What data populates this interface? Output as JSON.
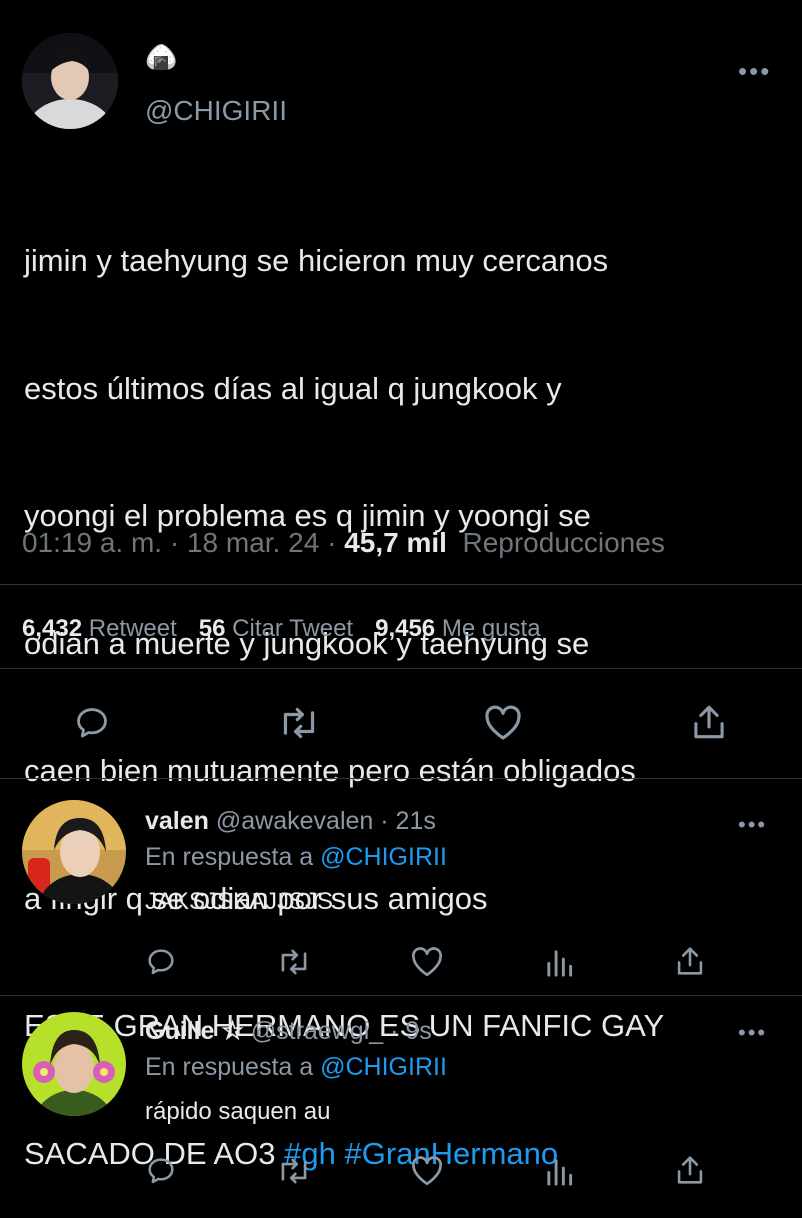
{
  "tweet": {
    "display_name_emoji": "🍙",
    "handle": "@CHIGIRII",
    "text_lines": [
      "jimin y taehyung se hicieron muy cercanos",
      "estos últimos días al igual q jungkook y",
      "yoongi el problema es q jimin y yoongi se",
      "odian a muerte y jungkook y taehyung se",
      "caen bien mutuamente pero están obligados",
      "a fingir q se odian por sus amigos",
      "ESTE GRAN HERMANO ES UN FANFIC GAY",
      "SACADO DE AO3 "
    ],
    "hashtags": [
      "#gh",
      "#GranHermano"
    ],
    "time": "01:19 a. m.",
    "date": "18 mar. 24",
    "views_count": "45,7 mil",
    "views_label": "Reproducciones",
    "retweets_count": "6,432",
    "retweets_label": "Retweet",
    "quotes_count": "56",
    "quotes_label": "Citar Tweet",
    "likes_count": "9,456",
    "likes_label": "Me gusta",
    "more": "•••"
  },
  "replies": [
    {
      "name": "valen",
      "handle": "@awakevalen",
      "time": "· 21s",
      "reply_to_label": "En respuesta a",
      "reply_to_handle": "@CHIGIRII",
      "text": "JAKSJSKAJJSJS",
      "more": "•••"
    },
    {
      "name": "Guille ☆",
      "handle": "@straewgi_",
      "time": "· 9s",
      "reply_to_label": "En respuesta a",
      "reply_to_handle": "@CHIGIRII",
      "text": "rápido saquen au",
      "more": "•••"
    }
  ],
  "icons": {
    "reply": "reply-icon",
    "retweet": "retweet-icon",
    "like": "heart-icon",
    "share": "share-icon",
    "analytics": "analytics-icon"
  },
  "colors": {
    "background": "#000000",
    "text": "#e7e9ea",
    "muted": "#8b98a5",
    "link": "#1d9bf0",
    "divider": "#2f3336"
  }
}
